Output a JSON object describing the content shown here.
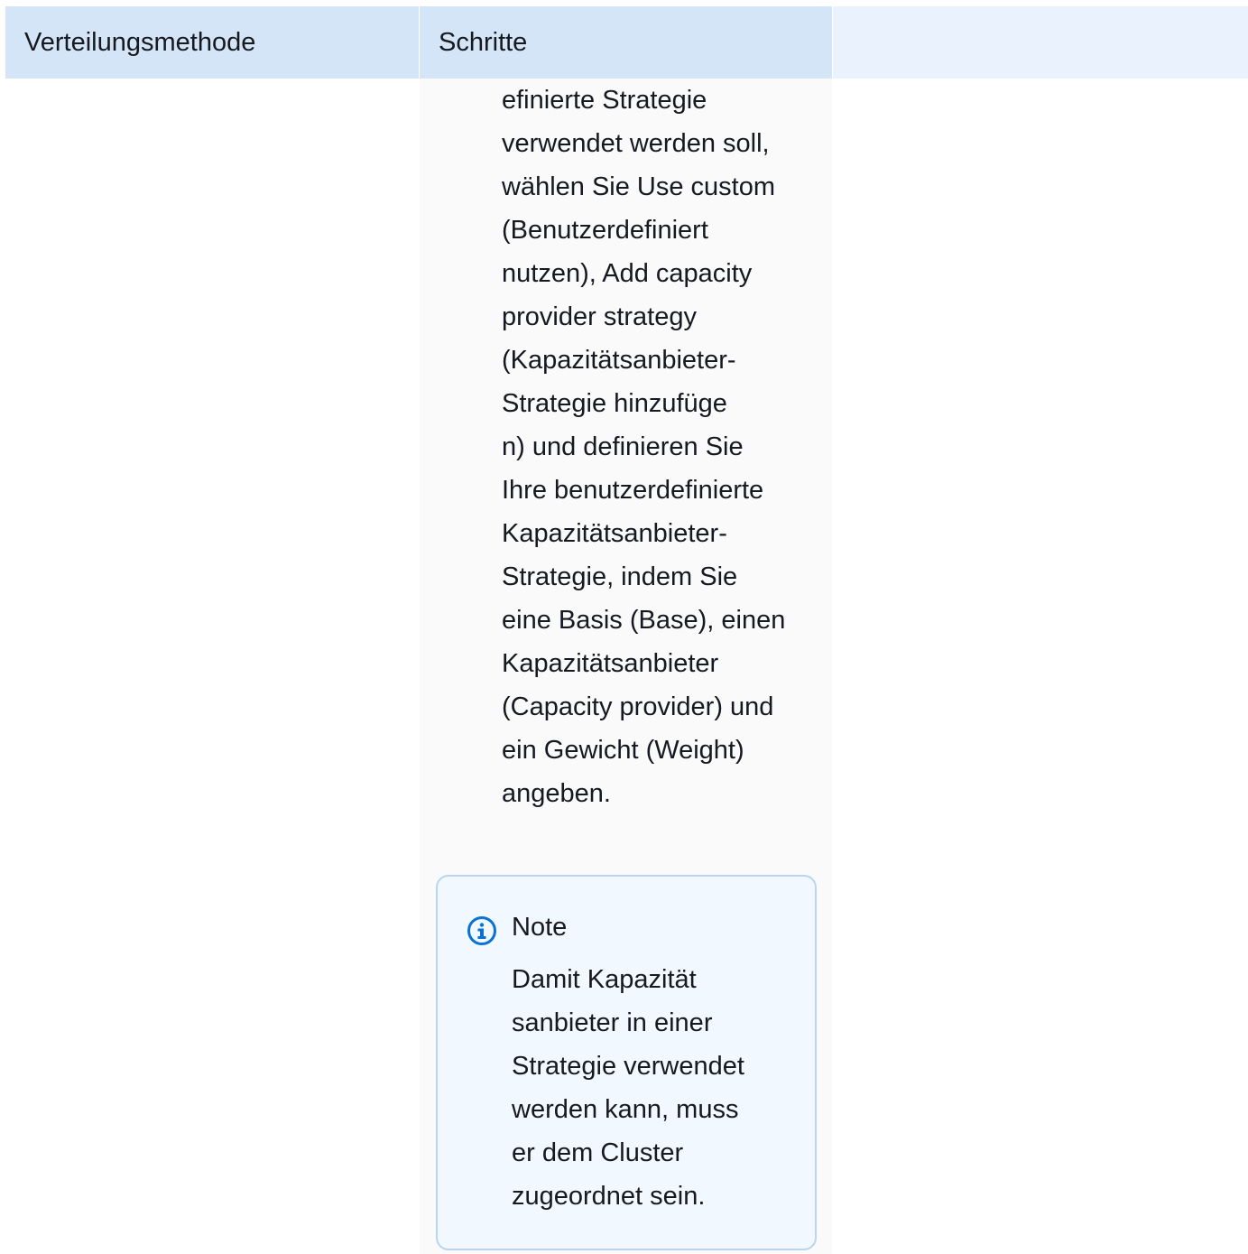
{
  "table": {
    "headers": {
      "method": "Verteilungsmethode",
      "steps": "Schritte"
    },
    "row": {
      "steps_text_lines": [
        "efinierte Strategie",
        "verwendet werden soll,",
        "wählen Sie Use custom",
        "(Benutzerdefiniert",
        "nutzen), Add capacity",
        "provider strategy",
        "(Kapazitätsanbieter-",
        "Strategie hinzufüge",
        "n) und definieren Sie",
        "Ihre benutzerdefinierte",
        "Kapazitätsanbieter-",
        "Strategie, indem Sie",
        "eine Basis (Base), einen",
        "Kapazitätsanbieter",
        "(Capacity provider) und",
        "ein Gewicht (Weight)",
        "angeben."
      ],
      "note": {
        "icon": "info-icon",
        "title": "Note",
        "text_lines": [
          "Damit Kapazität",
          "sanbieter in einer",
          "Strategie verwendet",
          "werden kann, muss",
          "er dem Cluster",
          "zugeordnet sein."
        ]
      }
    }
  },
  "colors": {
    "header_bg": "#d4e5f7",
    "header_empty_bg": "#e9f2fd",
    "steps_cell_bg": "#fafafa",
    "note_border": "#b9d5f0",
    "note_bg": "#f1f8ff",
    "info_icon": "#0972d3"
  }
}
